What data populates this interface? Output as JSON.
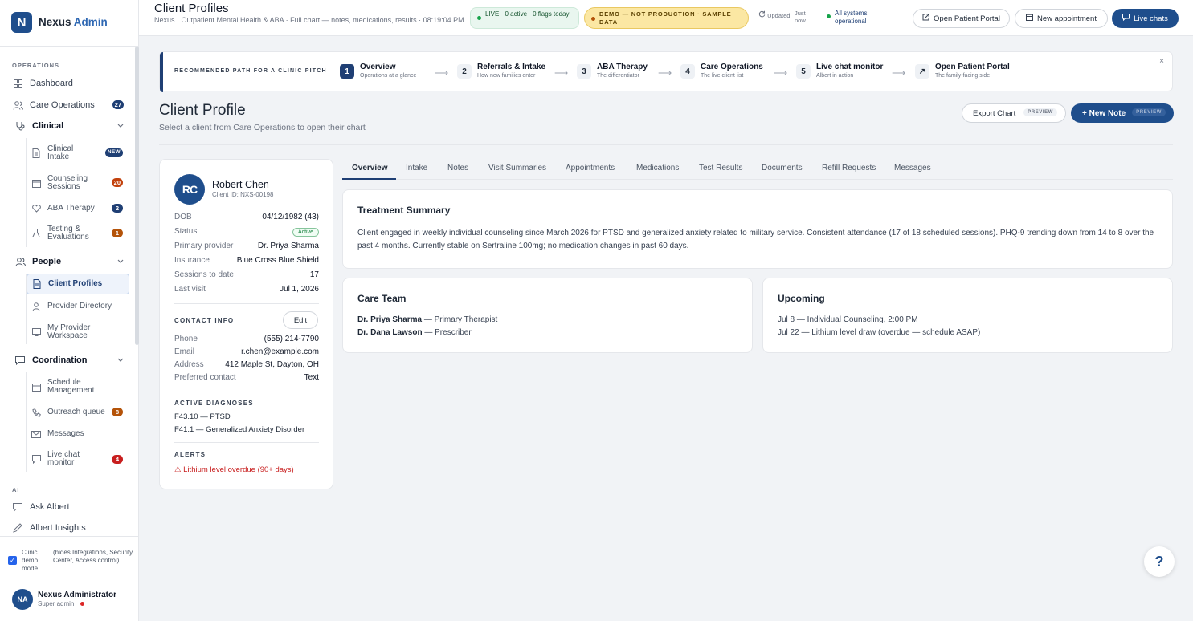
{
  "brand": {
    "logo": "N",
    "name": "Nexus",
    "suffix": "Admin"
  },
  "sidebar": {
    "operations_label": "OPERATIONS",
    "dashboard": "Dashboard",
    "care_ops": {
      "label": "Care Operations",
      "count": "27"
    },
    "clinical": {
      "label": "Clinical",
      "items": [
        {
          "label": "Clinical Intake",
          "badge": "NEW"
        },
        {
          "label": "Counseling Sessions",
          "badge": "20"
        },
        {
          "label": "ABA Therapy",
          "badge": "2"
        },
        {
          "label": "Testing & Evaluations",
          "badge": "1"
        }
      ]
    },
    "people": {
      "label": "People",
      "items": [
        {
          "label": "Client Profiles"
        },
        {
          "label": "Provider Directory"
        },
        {
          "label": "My Provider Workspace"
        }
      ]
    },
    "coordination": {
      "label": "Coordination",
      "items": [
        {
          "label": "Schedule Management"
        },
        {
          "label": "Outreach queue",
          "badge": "8"
        },
        {
          "label": "Messages"
        },
        {
          "label": "Live chat monitor",
          "badge": "4"
        }
      ]
    },
    "ai_label": "AI",
    "ask_albert": "Ask Albert",
    "albert_insights": "Albert Insights",
    "demo_mode": {
      "label": "Clinic demo mode",
      "hint": "(hides Integrations, Security Center, Access control)",
      "checked": true
    },
    "user": {
      "initials": "NA",
      "name": "Nexus Administrator",
      "role": "Super admin"
    }
  },
  "header": {
    "title": "Client Profiles",
    "subtitle": "Nexus · Outpatient Mental Health & ABA · Full chart — notes, medications, results · 08:19:04 PM",
    "live_status": "LIVE · 0 active · 0 flags today",
    "demo_banner": "DEMO — NOT PRODUCTION · SAMPLE DATA",
    "updated_label": "Updated",
    "updated_value": "Just now",
    "system_status": "All systems operational",
    "open_portal": "Open Patient Portal",
    "new_appointment": "New appointment",
    "live_chats": "Live chats"
  },
  "guide": {
    "title": "RECOMMENDED PATH FOR A CLINIC PITCH",
    "steps": [
      {
        "num": "1",
        "title": "Overview",
        "sub": "Operations at a glance"
      },
      {
        "num": "2",
        "title": "Referrals & Intake",
        "sub": "How new families enter"
      },
      {
        "num": "3",
        "title": "ABA Therapy",
        "sub": "The differentiator"
      },
      {
        "num": "4",
        "title": "Care Operations",
        "sub": "The live client list"
      },
      {
        "num": "5",
        "title": "Live chat monitor",
        "sub": "Albert in action"
      },
      {
        "num": "↗",
        "title": "Open Patient Portal",
        "sub": "The family-facing side"
      }
    ],
    "close": "×"
  },
  "page": {
    "title": "Client Profile",
    "subtitle": "Select a client from Care Operations to open their chart",
    "export": "Export Chart",
    "export_tag": "PREVIEW",
    "new_note": "+ New Note",
    "new_note_tag": "PREVIEW"
  },
  "client": {
    "initials": "RC",
    "name": "Robert Chen",
    "client_id": "Client ID: NXS-00198",
    "dob": {
      "k": "DOB",
      "v": "04/12/1982 (43)"
    },
    "status": {
      "k": "Status",
      "v": "Active"
    },
    "provider": {
      "k": "Primary provider",
      "v": "Dr. Priya Sharma"
    },
    "insurance": {
      "k": "Insurance",
      "v": "Blue Cross Blue Shield"
    },
    "sessions": {
      "k": "Sessions to date",
      "v": "17"
    },
    "last_visit": {
      "k": "Last visit",
      "v": "Jul 1, 2026"
    },
    "contact_label": "CONTACT INFO",
    "edit": "Edit",
    "phone": {
      "k": "Phone",
      "v": "(555) 214-7790"
    },
    "email": {
      "k": "Email",
      "v": "r.chen@example.com"
    },
    "address": {
      "k": "Address",
      "v": "412 Maple St, Dayton, OH"
    },
    "preferred": {
      "k": "Preferred contact",
      "v": "Text"
    },
    "diagnoses_label": "ACTIVE DIAGNOSES",
    "diagnoses": [
      "F43.10 — PTSD",
      "F41.1 — Generalized Anxiety Disorder"
    ],
    "alerts_label": "ALERTS",
    "alert": "⚠ Lithium level overdue (90+ days)"
  },
  "tabs": [
    "Overview",
    "Intake",
    "Notes",
    "Visit Summaries",
    "Appointments",
    "Medications",
    "Test Results",
    "Documents",
    "Refill Requests",
    "Messages"
  ],
  "summary": {
    "title": "Treatment Summary",
    "body": "Client engaged in weekly individual counseling since March 2026 for PTSD and generalized anxiety related to military service. Consistent attendance (17 of 18 scheduled sessions). PHQ-9 trending down from 14 to 8 over the past 4 months. Currently stable on Sertraline 100mg; no medication changes in past 60 days."
  },
  "care_team": {
    "title": "Care Team",
    "members": [
      {
        "name": "Dr. Priya Sharma",
        "role": " — Primary Therapist"
      },
      {
        "name": "Dr. Dana Lawson",
        "role": " — Prescriber"
      }
    ]
  },
  "upcoming": {
    "title": "Upcoming",
    "items": [
      "Jul 8 — Individual Counseling, 2:00 PM",
      "Jul 22 — Lithium level draw (overdue — schedule ASAP)"
    ]
  },
  "help": "?"
}
